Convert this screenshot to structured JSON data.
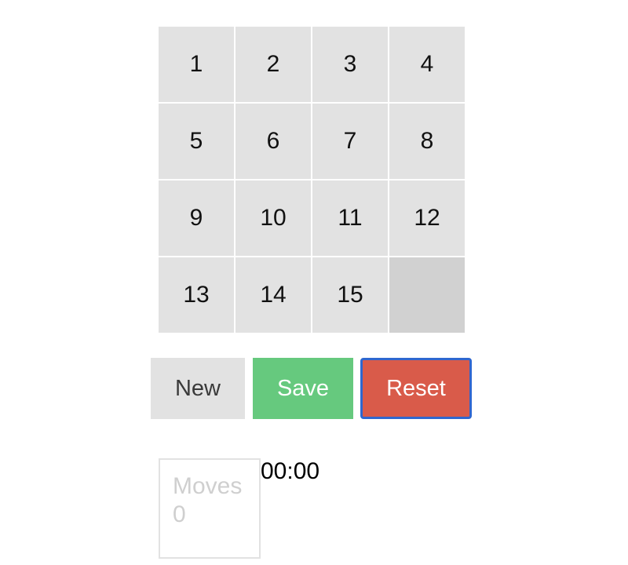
{
  "board": {
    "tiles": [
      "1",
      "2",
      "3",
      "4",
      "5",
      "6",
      "7",
      "8",
      "9",
      "10",
      "11",
      "12",
      "13",
      "14",
      "15",
      ""
    ]
  },
  "controls": {
    "new_label": "New",
    "save_label": "Save",
    "reset_label": "Reset"
  },
  "stats": {
    "moves_label": "Moves",
    "moves_value": "0",
    "timer": "00:00"
  },
  "colors": {
    "tile": "#e2e2e2",
    "empty_tile": "#d1d1d1",
    "save": "#66c97e",
    "reset": "#d95b4a",
    "focus_ring": "#2f67cf"
  }
}
